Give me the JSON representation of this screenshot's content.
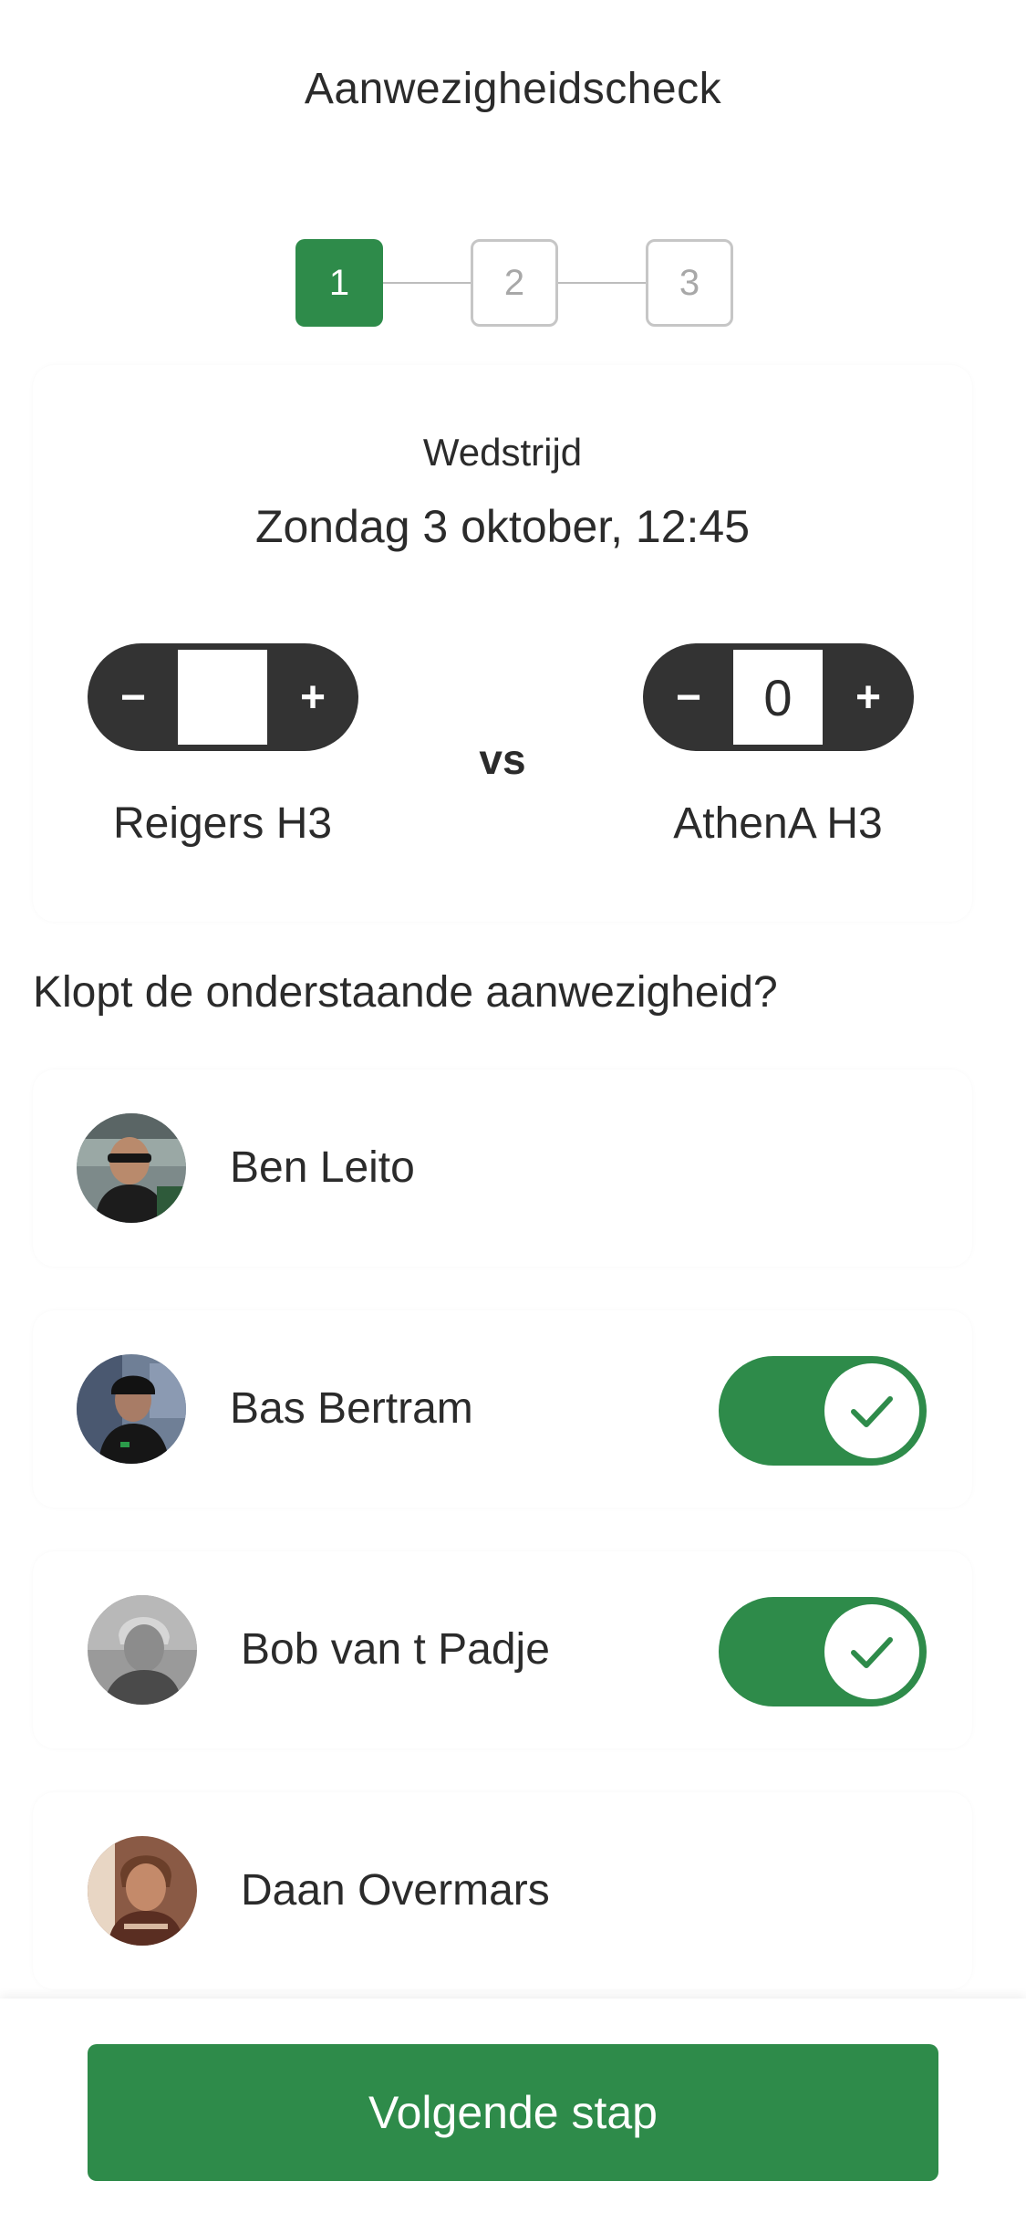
{
  "header": {
    "title": "Aanwezigheidscheck"
  },
  "stepper": {
    "steps": [
      "1",
      "2",
      "3"
    ],
    "active_step": 1
  },
  "match": {
    "label": "Wedstrijd",
    "date": "Zondag 3 oktober, 12:45",
    "vs": "vs",
    "home_team": {
      "name": "Reigers H3",
      "score": "",
      "minus_label": "−",
      "plus_label": "+"
    },
    "away_team": {
      "name": "AthenA H3",
      "score": "0",
      "minus_label": "−",
      "plus_label": "+"
    }
  },
  "attendance": {
    "question": "Klopt de onderstaande aanwezigheid?",
    "players": [
      {
        "name": "Ben Leito",
        "present_toggle": null,
        "avatar": "player-photo"
      },
      {
        "name": "Bas Bertram",
        "present_toggle": true,
        "avatar": "player-photo"
      },
      {
        "name": "Bob van t Padje",
        "present_toggle": true,
        "avatar": "player-photo"
      },
      {
        "name": "Daan Overmars",
        "present_toggle": null,
        "avatar": "player-photo"
      }
    ]
  },
  "footer": {
    "next_label": "Volgende stap"
  },
  "colors": {
    "accent": "#2e8b4a",
    "control_dark": "#333333",
    "text": "#2b2b2b",
    "inactive_border": "#c6c6c6"
  },
  "icons": {
    "toggle_on": "checkmark-icon"
  }
}
